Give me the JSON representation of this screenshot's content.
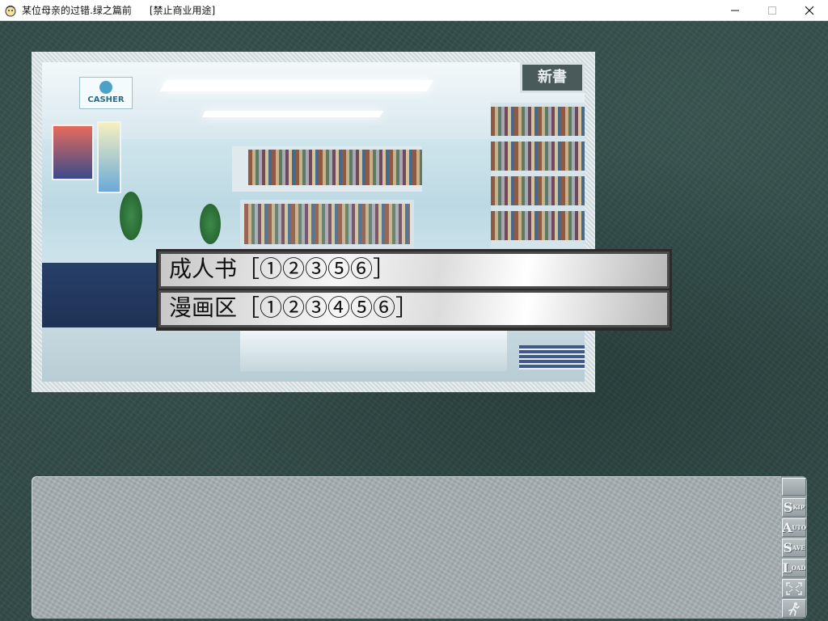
{
  "window": {
    "title": "某位母亲的过错.绿之篇前",
    "notice": "[禁止商业用途]",
    "icon": "game-app-icon",
    "controls": [
      "minimize-icon",
      "maximize-icon",
      "close-icon"
    ]
  },
  "scene": {
    "casher_sign": "CASHER",
    "top_sign": "新書"
  },
  "choices": [
    {
      "label": "成人书［①②③⑤⑥］"
    },
    {
      "label": "漫画区［①②③④⑤⑥］"
    }
  ],
  "message": {
    "text": ""
  },
  "side_buttons": [
    {
      "name": "blank",
      "big": "",
      "small": ""
    },
    {
      "name": "skip",
      "big": "S",
      "small": "KIP"
    },
    {
      "name": "auto",
      "big": "A",
      "small": "UTO"
    },
    {
      "name": "save",
      "big": "S",
      "small": "AVE"
    },
    {
      "name": "load",
      "big": "L",
      "small": "OAD"
    },
    {
      "name": "fullscreen",
      "icon": "fullscreen-icon"
    },
    {
      "name": "exit",
      "icon": "running-man-icon"
    }
  ],
  "colors": {
    "background": "#324b48",
    "message_box": "#a7b0b4",
    "choice_border": "#2b2b2b"
  }
}
